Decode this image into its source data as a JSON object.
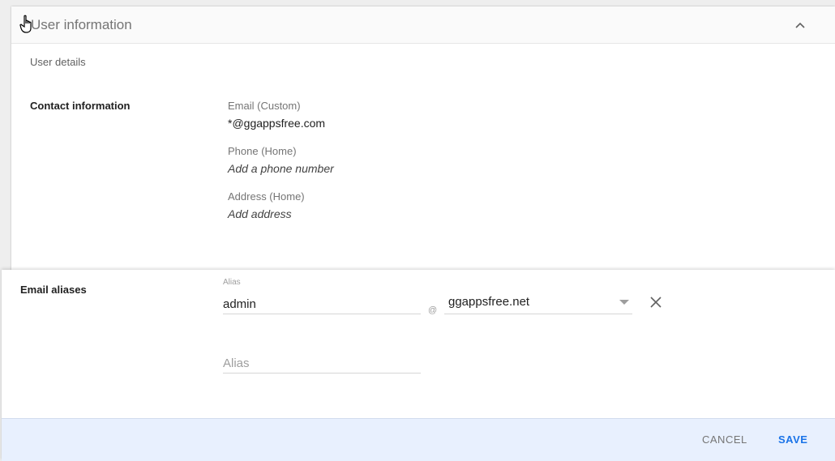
{
  "card": {
    "title": "User information",
    "collapse_icon": "chevron-up-icon",
    "cursor_icon": "hand-pointer-icon",
    "user_details_label": "User details",
    "contact_label": "Contact information",
    "fields": [
      {
        "label": "Email (Custom)",
        "value": "*@ggappsfree.com",
        "italic": false
      },
      {
        "label": "Phone (Home)",
        "value": "Add a phone number",
        "italic": true
      },
      {
        "label": "Address (Home)",
        "value": "Add address",
        "italic": true
      }
    ]
  },
  "aliases": {
    "section_label": "Email aliases",
    "float_label": "Alias",
    "alias_value": "admin",
    "at_sign": "@",
    "domain_value": "ggappsfree.net",
    "empty_placeholder": "Alias",
    "remove_icon": "close-icon",
    "dropdown_icon": "caret-down-icon"
  },
  "footer": {
    "cancel_label": "CANCEL",
    "save_label": "SAVE"
  },
  "colors": {
    "accent": "#1a73e8",
    "footer_bg": "#e8f0fe"
  }
}
